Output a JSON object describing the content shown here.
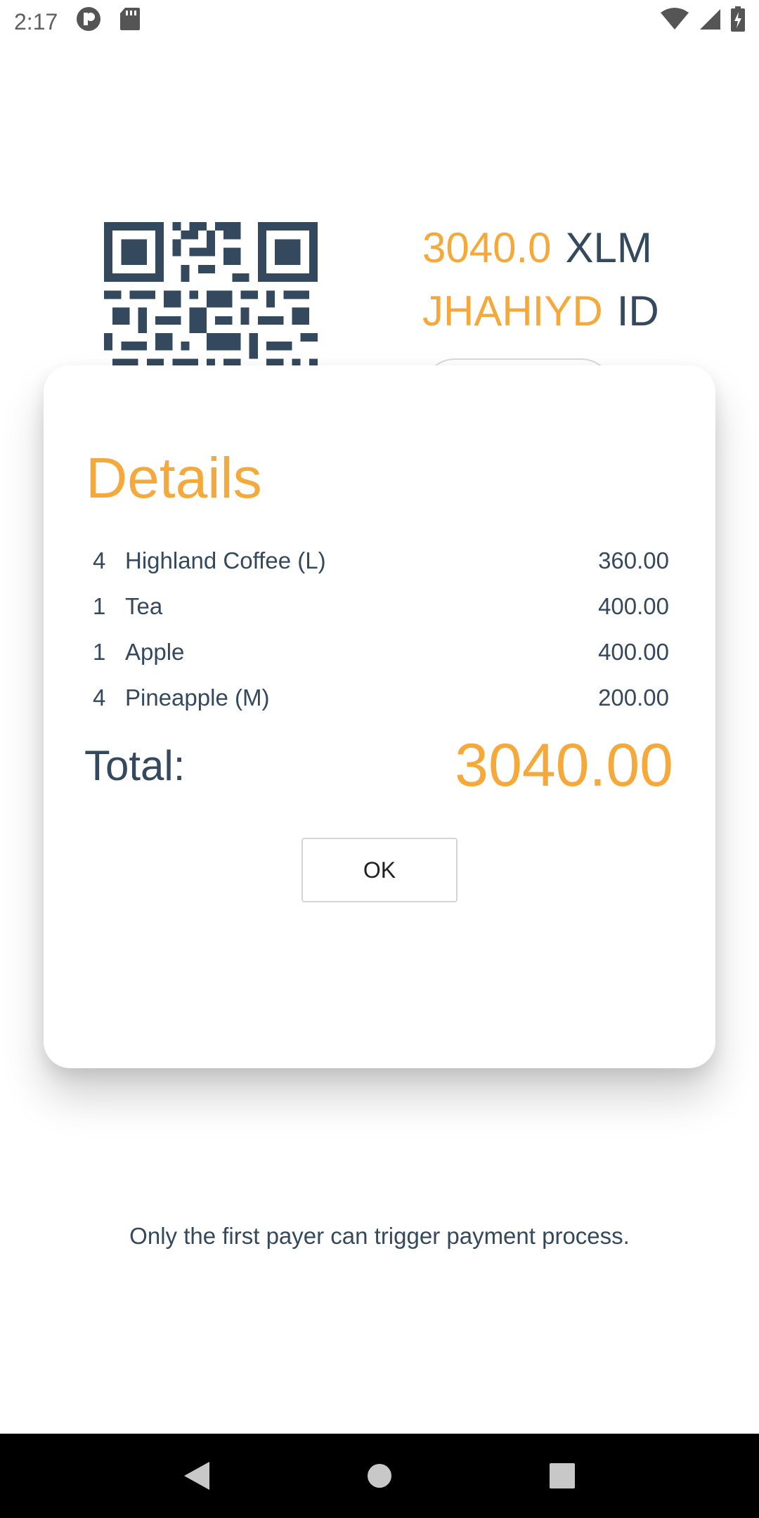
{
  "status_bar": {
    "time": "2:17",
    "icons": [
      "app-notification-icon",
      "sd-card-icon",
      "wifi-icon",
      "cell-signal-icon",
      "battery-charging-icon"
    ]
  },
  "invoice": {
    "amount": "3040.0",
    "currency": "XLM",
    "code": "JHAHIYD",
    "id_label": "ID"
  },
  "dialog": {
    "title": "Details",
    "items": [
      {
        "qty": "4",
        "name": "Highland Coffee (L)",
        "price": "360.00"
      },
      {
        "qty": "1",
        "name": "Tea",
        "price": "400.00"
      },
      {
        "qty": "1",
        "name": "Apple",
        "price": "400.00"
      },
      {
        "qty": "4",
        "name": "Pineapple (M)",
        "price": "200.00"
      }
    ],
    "total_label": "Total:",
    "total_value": "3040.00",
    "ok_label": "OK"
  },
  "footer": {
    "note": "Only the first payer can trigger payment process."
  },
  "colors": {
    "accent": "#f6a93b",
    "text": "#34495e",
    "nav_bar": "#000000"
  }
}
